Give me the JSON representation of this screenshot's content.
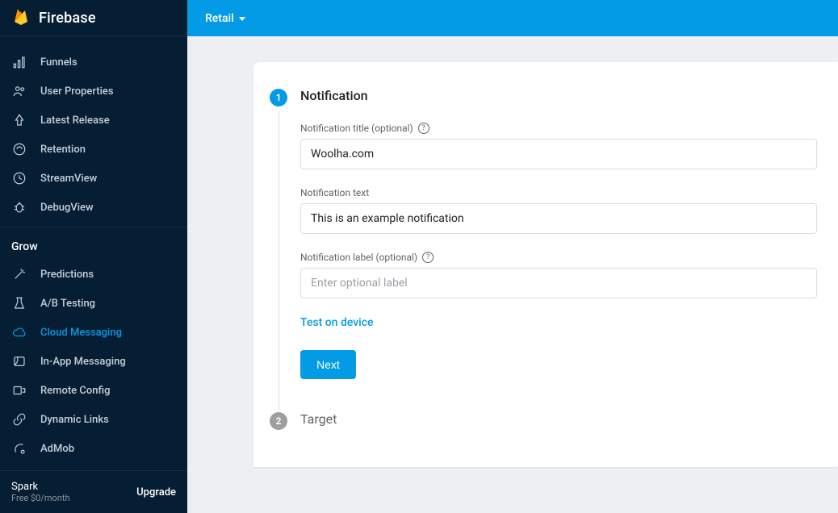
{
  "brand": {
    "name": "Firebase"
  },
  "topbar": {
    "project": "Retail"
  },
  "sidebar": {
    "analytics": [
      {
        "label": "Funnels",
        "icon": "funnel"
      },
      {
        "label": "User Properties",
        "icon": "users"
      },
      {
        "label": "Latest Release",
        "icon": "release"
      },
      {
        "label": "Retention",
        "icon": "retention"
      },
      {
        "label": "StreamView",
        "icon": "clock"
      },
      {
        "label": "DebugView",
        "icon": "bug"
      }
    ],
    "grow_title": "Grow",
    "grow": [
      {
        "label": "Predictions",
        "icon": "wand"
      },
      {
        "label": "A/B Testing",
        "icon": "flask"
      },
      {
        "label": "Cloud Messaging",
        "icon": "cloud",
        "active": true
      },
      {
        "label": "In-App Messaging",
        "icon": "inapp"
      },
      {
        "label": "Remote Config",
        "icon": "remote"
      },
      {
        "label": "Dynamic Links",
        "icon": "link"
      },
      {
        "label": "AdMob",
        "icon": "admob"
      }
    ]
  },
  "plan": {
    "name": "Spark",
    "price": "Free $0/month",
    "upgrade": "Upgrade"
  },
  "steps": {
    "s1": {
      "num": "1",
      "title": "Notification",
      "title_label": "Notification title (optional)",
      "title_value": "Woolha.com",
      "text_label": "Notification text",
      "text_value": "This is an example notification",
      "label_label": "Notification label (optional)",
      "label_placeholder": "Enter optional label",
      "test": "Test on device",
      "next": "Next"
    },
    "s2": {
      "num": "2",
      "title": "Target"
    }
  }
}
